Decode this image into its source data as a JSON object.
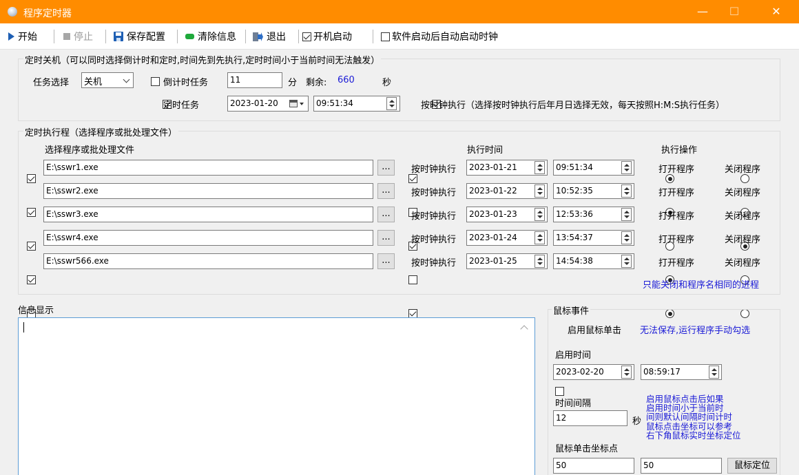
{
  "window": {
    "title": "程序定时器",
    "minimize": "—",
    "maximize": "☐",
    "close": "✕"
  },
  "toolbar": {
    "start": "开始",
    "stop": "停止",
    "save": "保存配置",
    "clear": "清除信息",
    "exit": "退出",
    "autostart": "开机启动",
    "autostart_checked": true,
    "auto_clock": "软件启动后自动启动时钟",
    "auto_clock_checked": false
  },
  "shutdown": {
    "group_title": "定时关机（可以同时选择倒计时和定时,时间先到先执行,定时时间小于当前时间无法触发）",
    "task_label": "任务选择",
    "task_value": "关机",
    "countdown_label": "倒计时任务",
    "countdown_checked": false,
    "countdown_value": "11",
    "minutes_unit": "分",
    "remaining_label": "剩余:",
    "remaining_value": "660",
    "seconds_unit": "秒",
    "timed_label": "定时任务",
    "timed_checked": true,
    "date": "2023-01-20",
    "time": "09:51:34",
    "clock_label": "按时钟执行（选择按时钟执行后年月日选择无效，每天按照H:M:S执行任务）",
    "clock_checked": true
  },
  "programs": {
    "group_title": "定时执行程（选择程序或批处理文件）",
    "col_file": "选择程序或批处理文件",
    "col_time": "执行时间",
    "col_action": "执行操作",
    "browse": "...",
    "clock_label": "按时钟执行",
    "open_label": "打开程序",
    "close_label": "关闭程序",
    "note": "只能关闭和程序名相同的进程",
    "rows": [
      {
        "enabled": true,
        "path": "E:\\sswr1.exe",
        "clock": true,
        "date": "2023-01-21",
        "time": "09:51:34",
        "action": "open"
      },
      {
        "enabled": true,
        "path": "E:\\sswr2.exe",
        "clock": false,
        "date": "2023-01-22",
        "time": "10:52:35",
        "action": "open"
      },
      {
        "enabled": true,
        "path": "E:\\sswr3.exe",
        "clock": true,
        "date": "2023-01-23",
        "time": "12:53:36",
        "action": "close"
      },
      {
        "enabled": true,
        "path": "E:\\sswr4.exe",
        "clock": false,
        "date": "2023-01-24",
        "time": "13:54:37",
        "action": "open"
      },
      {
        "enabled": false,
        "path": "E:\\sswr566.exe",
        "clock": true,
        "date": "2023-01-25",
        "time": "14:54:38",
        "action": "open"
      }
    ]
  },
  "info": {
    "title": "信息显示"
  },
  "mouse": {
    "group_title": "鼠标事件",
    "enable_label": "启用鼠标单击",
    "enable_checked": false,
    "enable_note": "无法保存,运行程序手动勾选",
    "start_time_label": "启用时间",
    "date": "2023-02-20",
    "time": "08:59:17",
    "interval_label": "时间间隔",
    "interval_value": "12",
    "seconds_unit": "秒",
    "note_lines": [
      "启用鼠标点击后如果",
      "启用时间小于当前时",
      "间则默认间隔时间计时",
      "鼠标点击坐标可以参考",
      "右下角鼠标实时坐标定位"
    ],
    "coords_label": "鼠标单击坐标点",
    "x": "50",
    "y": "50",
    "locate_button": "鼠标定位"
  },
  "colors": {
    "titlebar": "#ff8c00",
    "accent_blue": "#1a1ad6",
    "info_border": "#5b9bd5"
  }
}
